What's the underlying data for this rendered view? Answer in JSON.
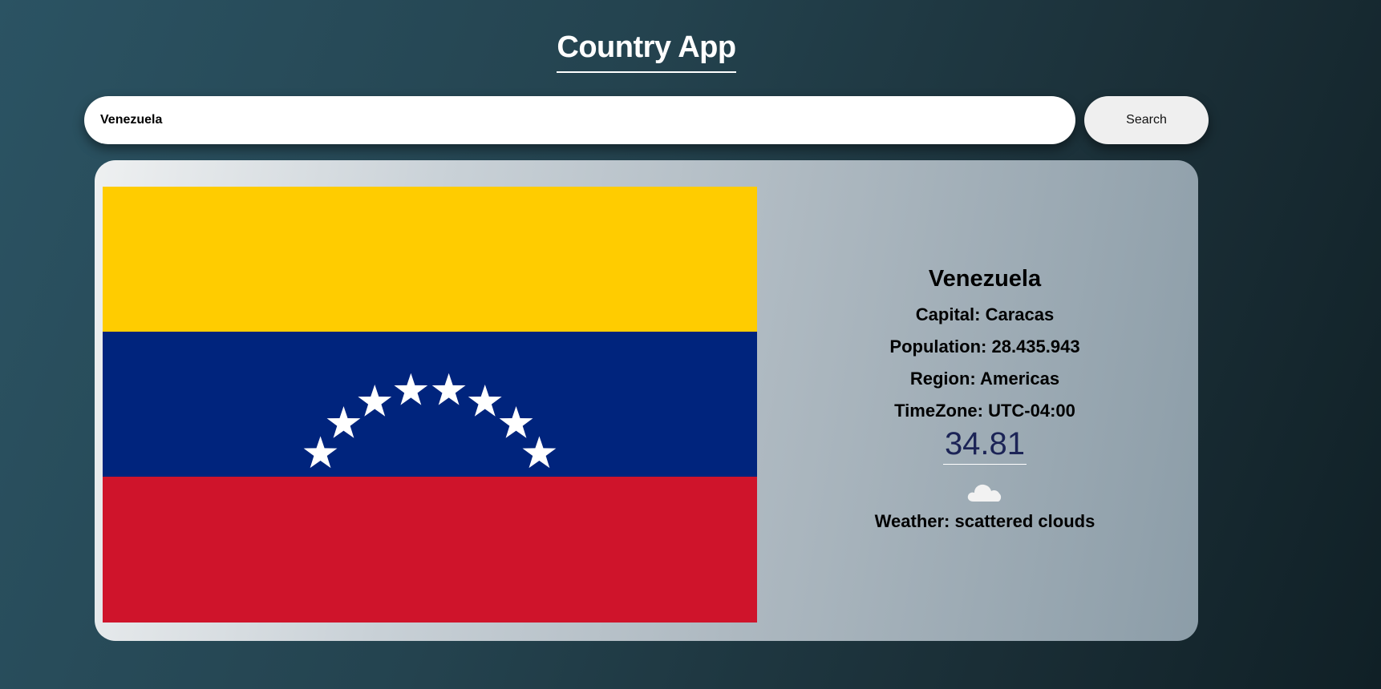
{
  "header": {
    "title": "Country App"
  },
  "search": {
    "value": "Venezuela",
    "button_label": "Search"
  },
  "country": {
    "name": "Venezuela",
    "capital": "Capital: Caracas",
    "population": "Population: 28.435.943",
    "region": "Region: Americas",
    "timezone": "TimeZone: UTC-04:00",
    "temperature": "34.81",
    "weather": "Weather: scattered clouds",
    "weather_icon": "cloud-icon",
    "flag": {
      "stripe_colors": [
        "#ffcc00",
        "#00247d",
        "#cf142b"
      ],
      "star_color": "#ffffff",
      "star_count": 8
    }
  }
}
